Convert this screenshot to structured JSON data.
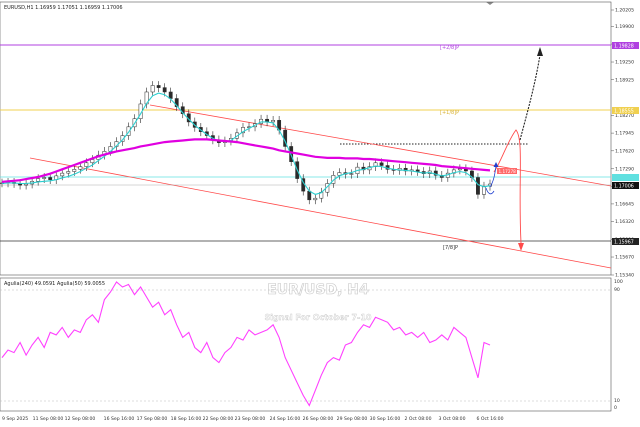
{
  "header": {
    "symbol_info": "EURUSD,H1  1.16959 1.17051 1.16959 1.17006"
  },
  "watermark": {
    "title": "EUR/USD, H4",
    "subtitle": "Signal For October 7-10"
  },
  "levels": {
    "upper_label": "[+2/8]P",
    "yellow_label": "[+1/8]P",
    "lower_label": "[7/8]P",
    "upper_price": "1.19828",
    "yellow_price": "1.18555",
    "lower_price": "1.15967",
    "current_price": "1.17006",
    "pink_price": "1.17278"
  },
  "indicator": {
    "label": "Agulia(240) 49.0591  Agulia(50) 59.0055"
  },
  "colors": {
    "candles": "#2a2a2a",
    "ma_fast": "#2ccfd0",
    "ma_slow": "#e000e0",
    "channel": "#ff4a4a",
    "murrey_upper": "#b040e0",
    "murrey_yellow": "#f0d050",
    "oscillator": "#ff40ff",
    "cyan_line": "#60e0e0"
  },
  "chart_data": {
    "type": "candlestick",
    "title": "EUR/USD, H4",
    "subtitle": "Signal For October 7-10",
    "yaxis": {
      "ticks": [
        "1.20205",
        "1.19900",
        "1.19580",
        "1.19250",
        "1.18925",
        "1.18270",
        "1.17945",
        "1.17620",
        "1.17290",
        "1.16970",
        "1.16645",
        "1.16320",
        "1.15990",
        "1.15670",
        "1.15340"
      ]
    },
    "xaxis": {
      "ticks": [
        "9 Sep 2025",
        "11 Sep 08:00",
        "12 Sep 08:00",
        "16 Sep 16:00",
        "17 Sep 08:00",
        "18 Sep 16:00",
        "22 Sep 08:00",
        "23 Sep 08:00",
        "24 Sep 16:00",
        "26 Sep 08:00",
        "29 Sep 08:00",
        "30 Sep 16:00",
        "2 Oct 08:00",
        "3 Oct 08:00",
        "6 Oct 16:00"
      ]
    },
    "close_prices": [
      1.1703,
      1.1704,
      1.1702,
      1.1699,
      1.1701,
      1.1706,
      1.1711,
      1.1713,
      1.1709,
      1.1716,
      1.1721,
      1.1724,
      1.1728,
      1.1733,
      1.174,
      1.1746,
      1.1754,
      1.1761,
      1.177,
      1.1779,
      1.179,
      1.1806,
      1.1821,
      1.1848,
      1.187,
      1.1882,
      1.1878,
      1.187,
      1.1858,
      1.1843,
      1.183,
      1.1815,
      1.1805,
      1.1797,
      1.179,
      1.1782,
      1.1777,
      1.178,
      1.1785,
      1.1795,
      1.1805,
      1.1806,
      1.1812,
      1.182,
      1.1815,
      1.1818,
      1.18,
      1.177,
      1.1742,
      1.1711,
      1.1688,
      1.1672,
      1.1675,
      1.1686,
      1.1702,
      1.1717,
      1.1722,
      1.1719,
      1.172,
      1.1732,
      1.1727,
      1.1733,
      1.174,
      1.1735,
      1.1728,
      1.1726,
      1.173,
      1.1725,
      1.1727,
      1.1724,
      1.172,
      1.1725,
      1.1717,
      1.1713,
      1.1721,
      1.1727,
      1.1729,
      1.1725,
      1.1713,
      1.1682,
      1.1697,
      1.1701
    ],
    "ma_fast": [
      1.1702,
      1.1703,
      1.1703,
      1.1702,
      1.1702,
      1.1703,
      1.1705,
      1.1706,
      1.1707,
      1.1709,
      1.1712,
      1.1715,
      1.1719,
      1.1724,
      1.173,
      1.1736,
      1.1744,
      1.1752,
      1.1761,
      1.1771,
      1.1782,
      1.1796,
      1.1812,
      1.183,
      1.1849,
      1.1863,
      1.1868,
      1.1865,
      1.1857,
      1.1845,
      1.1832,
      1.182,
      1.1809,
      1.18,
      1.1792,
      1.1785,
      1.178,
      1.1779,
      1.1781,
      1.1789,
      1.1797,
      1.1803,
      1.1809,
      1.1815,
      1.1815,
      1.1813,
      1.18,
      1.1779,
      1.1754,
      1.1727,
      1.1704,
      1.1688,
      1.1682,
      1.1685,
      1.1696,
      1.1708,
      1.1716,
      1.172,
      1.1722,
      1.1726,
      1.1728,
      1.1731,
      1.1734,
      1.1733,
      1.173,
      1.1728,
      1.1727,
      1.1726,
      1.1725,
      1.1723,
      1.1721,
      1.1722,
      1.1719,
      1.1716,
      1.1718,
      1.1722,
      1.1724,
      1.1722,
      1.1714,
      1.17,
      1.1696,
      1.1698
    ],
    "ma_slow": [
      1.1705,
      1.1706,
      1.1707,
      1.1708,
      1.171,
      1.1712,
      1.1714,
      1.1717,
      1.172,
      1.1724,
      1.1728,
      1.1732,
      1.1736,
      1.174,
      1.1744,
      1.1748,
      1.1752,
      1.1755,
      1.1758,
      1.1761,
      1.1763,
      1.1765,
      1.1767,
      1.177,
      1.1772,
      1.1774,
      1.1776,
      1.1778,
      1.1779,
      1.178,
      1.1781,
      1.1782,
      1.1783,
      1.1783,
      1.1783,
      1.1782,
      1.1781,
      1.178,
      1.1779,
      1.1778,
      1.1776,
      1.1774,
      1.1772,
      1.177,
      1.1768,
      1.1766,
      1.1763,
      1.1761,
      1.1759,
      1.1757,
      1.1755,
      1.1753,
      1.1751,
      1.175,
      1.1749,
      1.1749,
      1.1749,
      1.1748,
      1.1748,
      1.1748,
      1.1747,
      1.1747,
      1.1746,
      1.1745,
      1.1744,
      1.1743,
      1.1742,
      1.1741,
      1.174,
      1.1739,
      1.1738,
      1.1737,
      1.1736,
      1.1734,
      1.1733,
      1.1732,
      1.1731,
      1.173,
      1.1729,
      1.1728,
      1.1727,
      1.1726
    ],
    "oscillator": [
      40,
      46,
      44,
      52,
      42,
      50,
      56,
      48,
      60,
      58,
      64,
      56,
      62,
      60,
      70,
      74,
      68,
      86,
      92,
      100,
      96,
      98,
      90,
      96,
      88,
      80,
      84,
      74,
      78,
      66,
      56,
      60,
      48,
      44,
      52,
      40,
      36,
      44,
      48,
      56,
      54,
      62,
      58,
      60,
      62,
      66,
      56,
      40,
      30,
      20,
      10,
      2,
      14,
      26,
      36,
      40,
      38,
      50,
      52,
      60,
      66,
      64,
      72,
      70,
      68,
      62,
      64,
      58,
      60,
      56,
      60,
      52,
      54,
      58,
      54,
      64,
      60,
      56,
      40,
      24,
      52,
      50
    ],
    "oscillator_levels": [
      10,
      90
    ],
    "murrey_levels": {
      "+2/8": 1.19828,
      "+1/8": 1.18555,
      "7/8": 1.15967
    },
    "current_price": 1.17006
  }
}
